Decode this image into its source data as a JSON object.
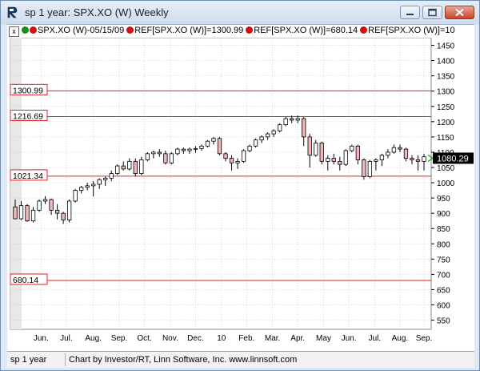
{
  "window": {
    "title": "sp 1 year: SPX.XO (W) Weekly",
    "icon": "investor-rt-r-icon"
  },
  "toolbar": {
    "close_box": "x",
    "symbol_label": "SPX.XO (W)-05/15/09",
    "refs": [
      {
        "label": "REF[SPX.XO (W)]=1300.99"
      },
      {
        "label": "REF[SPX.XO (W)]=680.14"
      },
      {
        "label": "REF[SPX.XO (W)]=10"
      }
    ]
  },
  "status": {
    "left": "sp 1 year",
    "credit": "Chart by Investor/RT, Linn Software, Inc. www.linnsoft.com"
  },
  "colors": {
    "up_candle": "#ffffff",
    "down_candle": "#f2b5b8",
    "ref_line": "#e02020",
    "grid": "#c8c8c8",
    "price_marker": "#000000",
    "arrow": "#10a010"
  },
  "chart_data": {
    "type": "candlestick",
    "y_axis_ticks": [
      550,
      600,
      650,
      700,
      750,
      800,
      850,
      900,
      950,
      1000,
      1050,
      1100,
      1150,
      1200,
      1250,
      1300,
      1350,
      1400,
      1450
    ],
    "ylim": [
      520,
      1475
    ],
    "x_axis_labels": [
      "Jun.",
      "Jul.",
      "Aug.",
      "Sep.",
      "Oct.",
      "Nov.",
      "Dec.",
      "10",
      "Feb.",
      "Mar.",
      "Apr.",
      "May",
      "Jun.",
      "Jul.",
      "Aug.",
      "Sep."
    ],
    "reference_lines": [
      {
        "label": "1300.99",
        "value": 1300.99
      },
      {
        "label": "1216.69",
        "value": 1216.69
      },
      {
        "label": "1021.34",
        "value": 1021.34
      },
      {
        "label": "680.14",
        "value": 680.14
      }
    ],
    "last_price_label": "1080.29",
    "last_price": 1080.29,
    "candles": [
      [
        921,
        945,
        880,
        882
      ],
      [
        882,
        940,
        878,
        925
      ],
      [
        925,
        930,
        872,
        875
      ],
      [
        875,
        920,
        870,
        910
      ],
      [
        910,
        945,
        905,
        940
      ],
      [
        940,
        956,
        930,
        945
      ],
      [
        945,
        948,
        895,
        910
      ],
      [
        910,
        930,
        880,
        900
      ],
      [
        900,
        905,
        865,
        878
      ],
      [
        878,
        945,
        870,
        940
      ],
      [
        940,
        980,
        935,
        975
      ],
      [
        975,
        990,
        965,
        985
      ],
      [
        985,
        1000,
        975,
        990
      ],
      [
        990,
        1005,
        955,
        995
      ],
      [
        995,
        1015,
        980,
        1010
      ],
      [
        1010,
        1020,
        990,
        1015
      ],
      [
        1015,
        1040,
        1005,
        1030
      ],
      [
        1030,
        1060,
        1025,
        1055
      ],
      [
        1055,
        1070,
        1040,
        1045
      ],
      [
        1045,
        1080,
        1040,
        1070
      ],
      [
        1070,
        1080,
        1020,
        1030
      ],
      [
        1030,
        1085,
        1025,
        1075
      ],
      [
        1075,
        1100,
        1070,
        1095
      ],
      [
        1095,
        1105,
        1080,
        1100
      ],
      [
        1100,
        1110,
        1085,
        1095
      ],
      [
        1095,
        1105,
        1060,
        1065
      ],
      [
        1065,
        1100,
        1060,
        1095
      ],
      [
        1095,
        1115,
        1090,
        1110
      ],
      [
        1110,
        1115,
        1095,
        1105
      ],
      [
        1105,
        1115,
        1095,
        1110
      ],
      [
        1110,
        1120,
        1098,
        1112
      ],
      [
        1112,
        1125,
        1105,
        1120
      ],
      [
        1120,
        1140,
        1115,
        1136
      ],
      [
        1136,
        1150,
        1125,
        1145
      ],
      [
        1145,
        1150,
        1090,
        1095
      ],
      [
        1095,
        1100,
        1070,
        1080
      ],
      [
        1080,
        1090,
        1040,
        1065
      ],
      [
        1065,
        1080,
        1045,
        1070
      ],
      [
        1070,
        1110,
        1065,
        1105
      ],
      [
        1105,
        1125,
        1100,
        1120
      ],
      [
        1120,
        1145,
        1115,
        1140
      ],
      [
        1140,
        1155,
        1130,
        1150
      ],
      [
        1150,
        1165,
        1140,
        1160
      ],
      [
        1160,
        1175,
        1150,
        1170
      ],
      [
        1170,
        1195,
        1165,
        1190
      ],
      [
        1190,
        1215,
        1185,
        1210
      ],
      [
        1210,
        1220,
        1195,
        1205
      ],
      [
        1205,
        1220,
        1195,
        1210
      ],
      [
        1210,
        1215,
        1120,
        1150
      ],
      [
        1150,
        1160,
        1050,
        1090
      ],
      [
        1090,
        1140,
        1085,
        1130
      ],
      [
        1130,
        1135,
        1060,
        1070
      ],
      [
        1070,
        1090,
        1040,
        1080
      ],
      [
        1080,
        1095,
        1060,
        1070
      ],
      [
        1070,
        1085,
        1040,
        1060
      ],
      [
        1060,
        1110,
        1055,
        1105
      ],
      [
        1105,
        1125,
        1100,
        1120
      ],
      [
        1120,
        1125,
        1060,
        1075
      ],
      [
        1075,
        1080,
        1010,
        1020
      ],
      [
        1020,
        1075,
        1015,
        1070
      ],
      [
        1070,
        1080,
        1040,
        1075
      ],
      [
        1075,
        1095,
        1055,
        1090
      ],
      [
        1090,
        1110,
        1080,
        1100
      ],
      [
        1100,
        1125,
        1095,
        1115
      ],
      [
        1115,
        1125,
        1100,
        1110
      ],
      [
        1110,
        1115,
        1070,
        1080
      ],
      [
        1080,
        1090,
        1060,
        1075
      ],
      [
        1075,
        1090,
        1040,
        1070
      ],
      [
        1070,
        1095,
        1040,
        1085
      ]
    ]
  }
}
